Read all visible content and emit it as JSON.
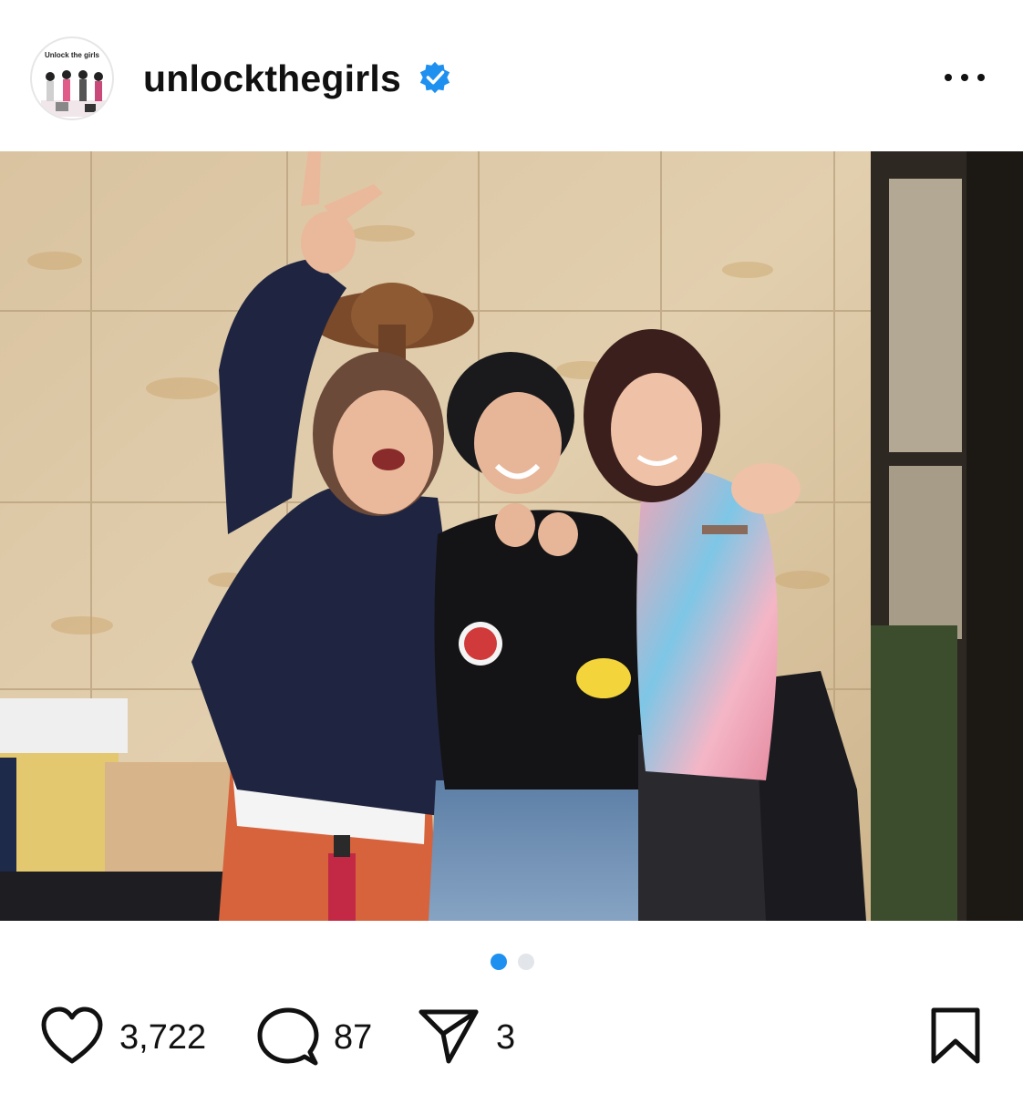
{
  "post": {
    "username": "unlockthegirls",
    "verified": true,
    "avatar_text": "Unlock the girls",
    "accent_color": "#1e90f0"
  },
  "carousel": {
    "total": 2,
    "current": 1
  },
  "actions": {
    "likes": "3,722",
    "comments": "87",
    "shares": "3"
  },
  "icons": {
    "verified": "verified-badge-icon",
    "more": "more-horizontal-icon",
    "like": "heart-icon",
    "comment": "comment-bubble-icon",
    "share": "paper-plane-icon",
    "save": "bookmark-icon"
  }
}
